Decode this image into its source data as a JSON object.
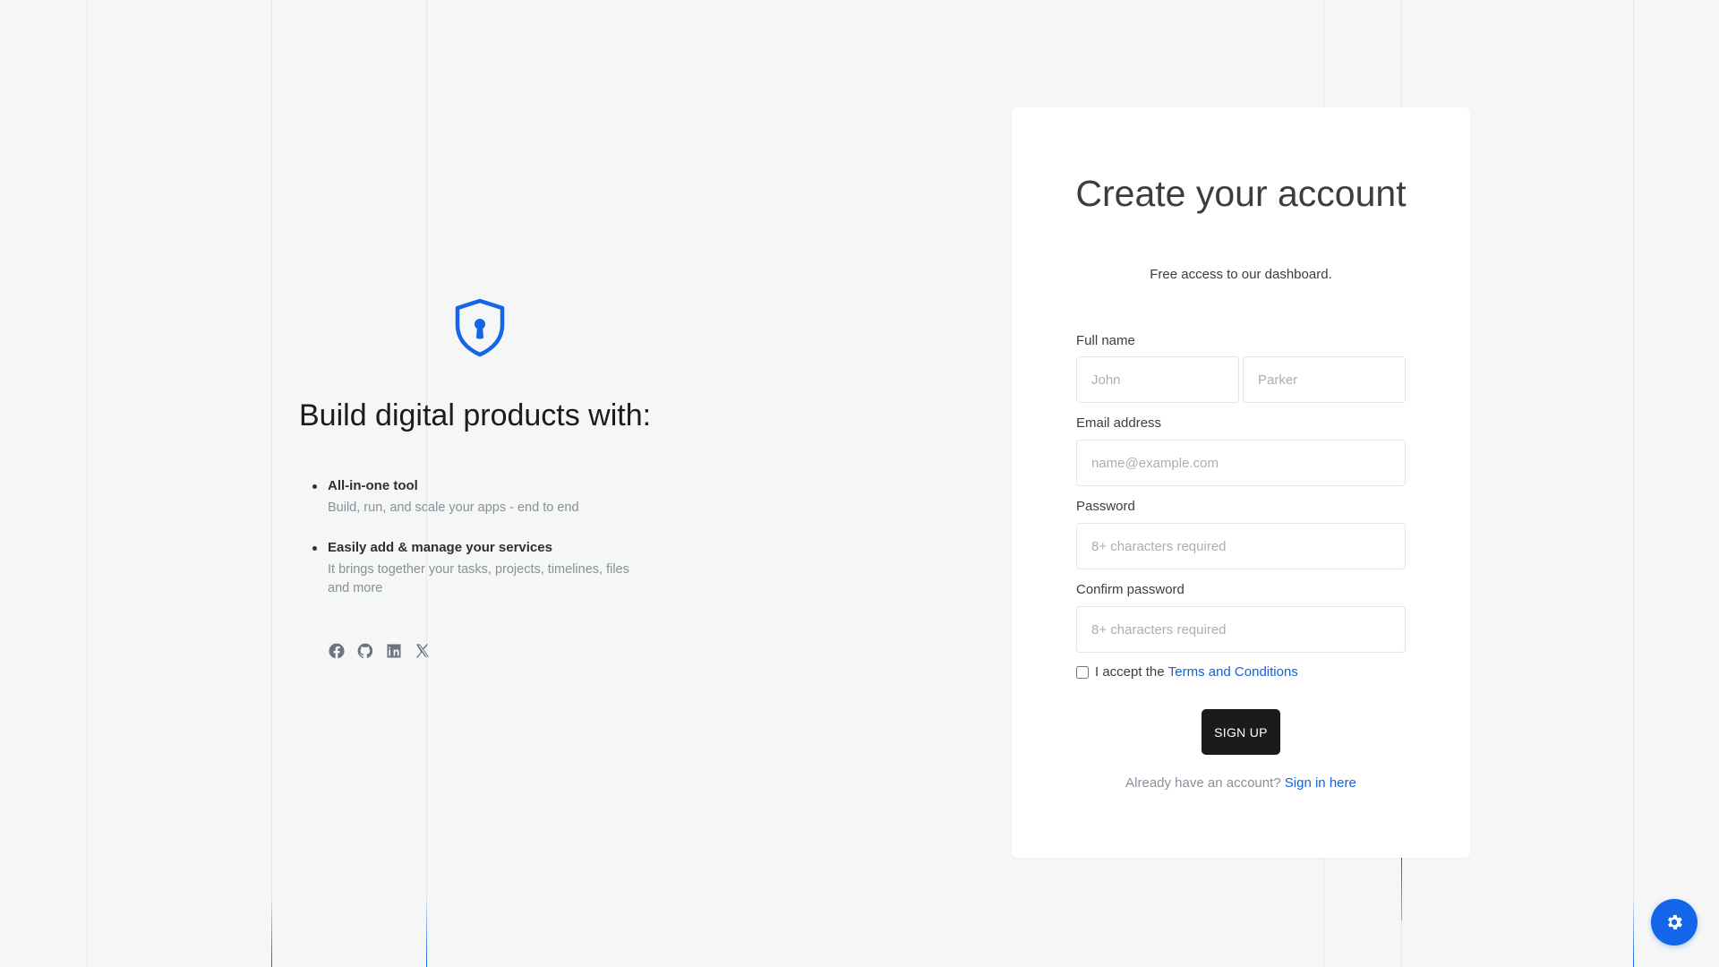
{
  "hero": {
    "title": "Build digital products with:",
    "features": [
      {
        "title": "All-in-one tool",
        "description": "Build, run, and scale your apps - end to end"
      },
      {
        "title": "Easily add & manage your services",
        "description": "It brings together your tasks, projects, timelines, files and more"
      }
    ],
    "socials": [
      "facebook-icon",
      "github-icon",
      "linkedin-icon",
      "x-icon"
    ]
  },
  "signup": {
    "title": "Create your account",
    "subtitle": "Free access to our dashboard.",
    "full_name_label": "Full name",
    "first_name_placeholder": "John",
    "last_name_placeholder": "Parker",
    "email_label": "Email address",
    "email_placeholder": "name@example.com",
    "password_label": "Password",
    "password_placeholder": "8+ characters required",
    "confirm_label": "Confirm password",
    "confirm_placeholder": "8+ characters required",
    "terms_prefix": "I accept the",
    "terms_link": "Terms and Conditions",
    "button_label": "SIGN UP",
    "signin_prefix": "Already have an account?",
    "signin_link": "Sign in here"
  },
  "colors": {
    "accent": "#1366e8",
    "button": "#1b1b1b",
    "background": "#f5f6f6"
  }
}
